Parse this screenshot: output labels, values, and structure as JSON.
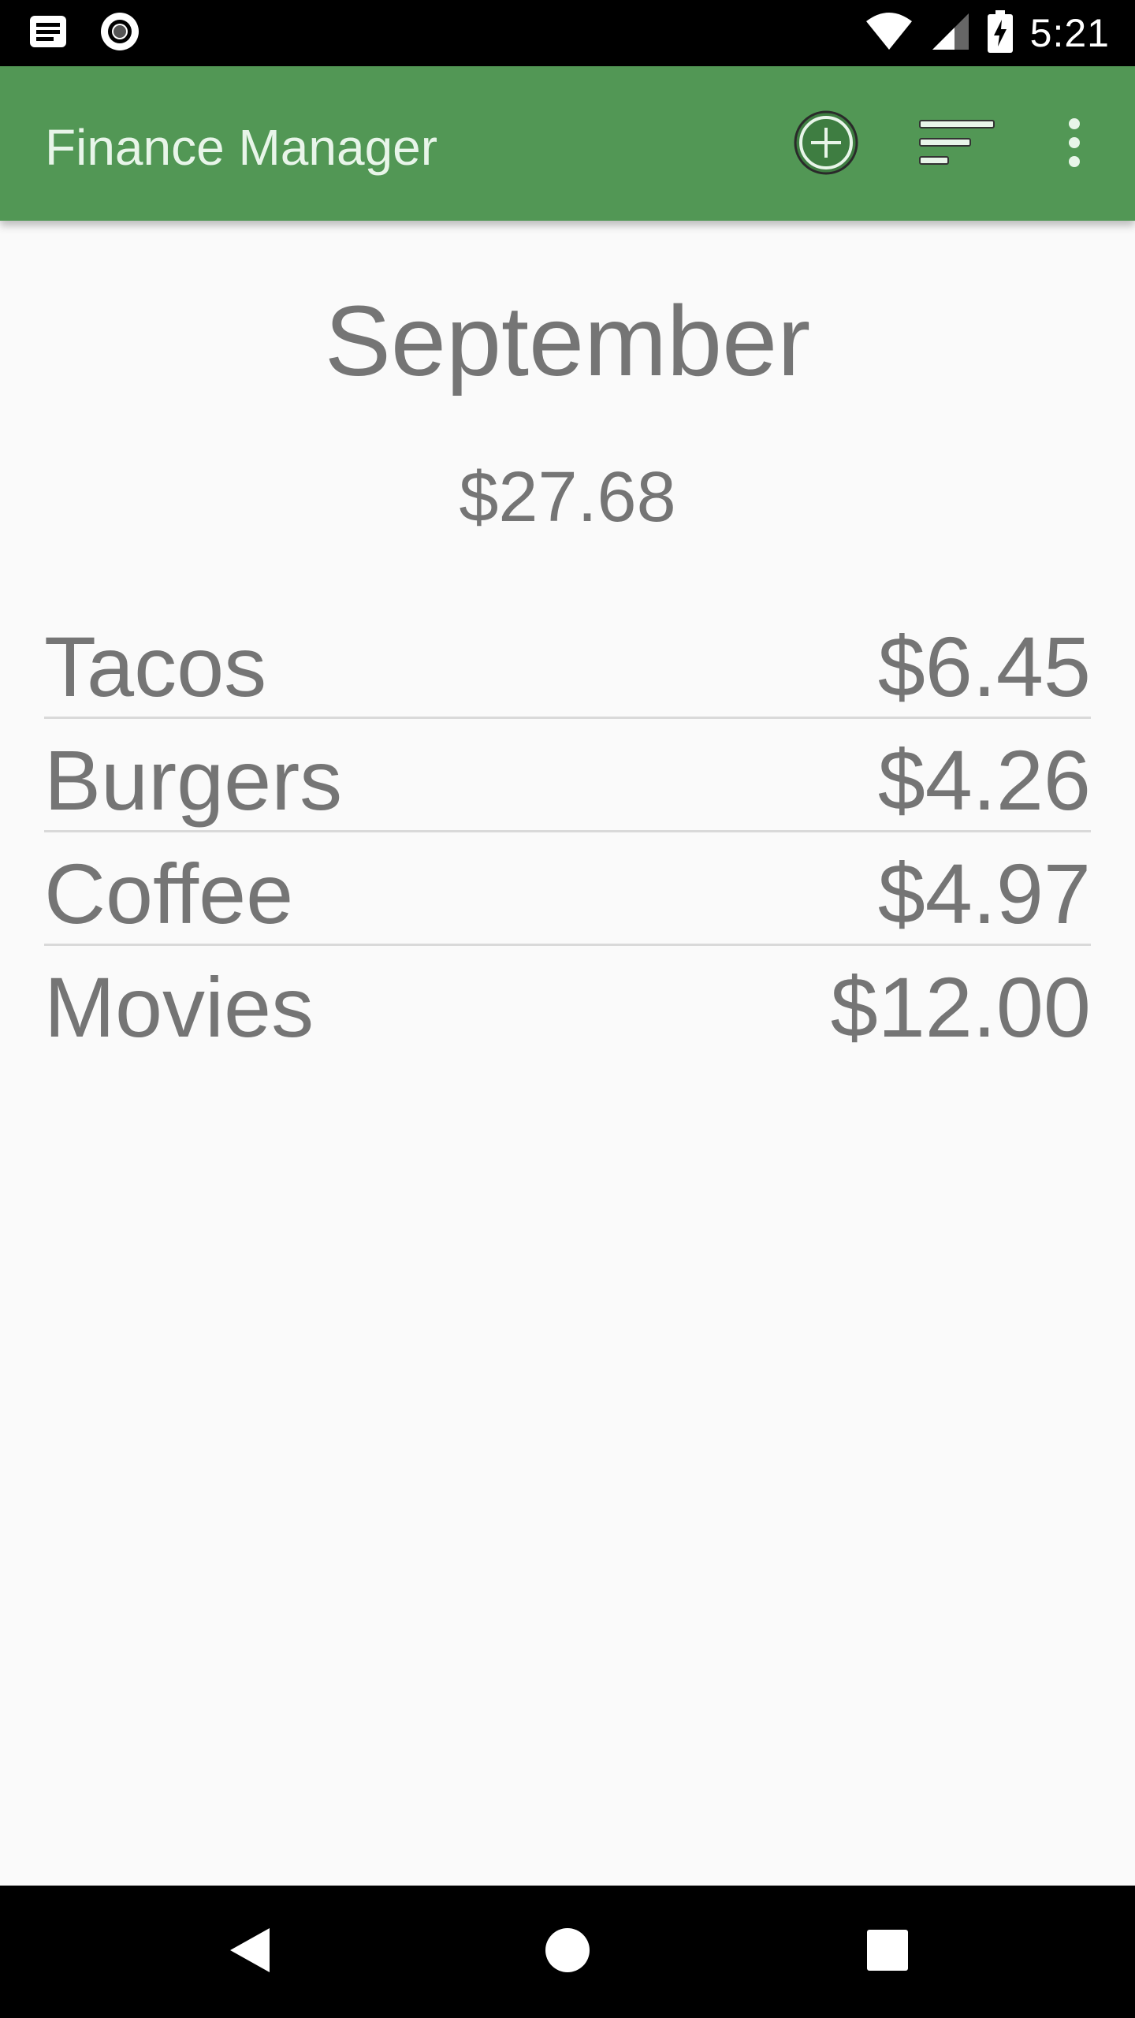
{
  "status_bar": {
    "time": "5:21",
    "icons": [
      "notification-icon",
      "record-icon",
      "wifi-icon",
      "cell-signal-icon",
      "battery-charging-icon"
    ]
  },
  "app_bar": {
    "title": "Finance Manager",
    "background": "#529755",
    "actions": [
      "add-circle-icon",
      "sort-icon",
      "more-vert-icon"
    ]
  },
  "summary": {
    "month": "September",
    "total": "$27.68"
  },
  "expenses": [
    {
      "name": "Tacos",
      "amount": "$6.45"
    },
    {
      "name": "Burgers",
      "amount": "$4.26"
    },
    {
      "name": "Coffee",
      "amount": "$4.97"
    },
    {
      "name": "Movies",
      "amount": "$12.00"
    }
  ],
  "nav_bar": {
    "buttons": [
      "back-icon",
      "home-icon",
      "recents-icon"
    ]
  }
}
